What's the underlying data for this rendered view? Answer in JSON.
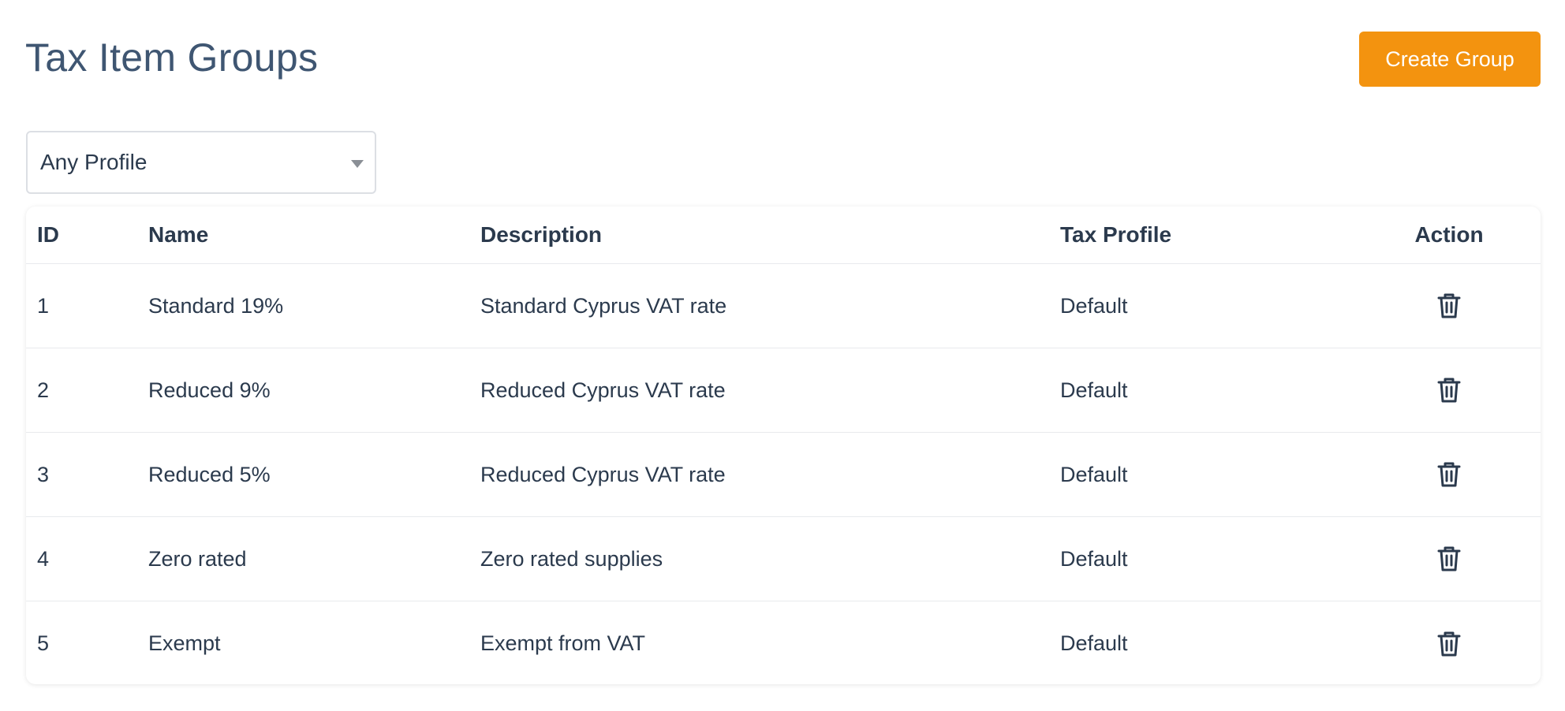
{
  "header": {
    "title": "Tax Item Groups",
    "create_label": "Create Group"
  },
  "filter": {
    "selected": "Any Profile",
    "icon": "chevron-down-icon"
  },
  "table": {
    "columns": {
      "id": "ID",
      "name": "Name",
      "description": "Description",
      "tax_profile": "Tax Profile",
      "action": "Action"
    },
    "rows": [
      {
        "id": "1",
        "name": "Standard 19%",
        "description": "Standard Cyprus VAT rate",
        "tax_profile": "Default",
        "action_icon": "trash-icon"
      },
      {
        "id": "2",
        "name": "Reduced 9%",
        "description": "Reduced Cyprus VAT rate",
        "tax_profile": "Default",
        "action_icon": "trash-icon"
      },
      {
        "id": "3",
        "name": "Reduced 5%",
        "description": "Reduced Cyprus VAT rate",
        "tax_profile": "Default",
        "action_icon": "trash-icon"
      },
      {
        "id": "4",
        "name": "Zero rated",
        "description": "Zero rated supplies",
        "tax_profile": "Default",
        "action_icon": "trash-icon"
      },
      {
        "id": "5",
        "name": "Exempt",
        "description": "Exempt from VAT",
        "tax_profile": "Default",
        "action_icon": "trash-icon"
      }
    ]
  },
  "colors": {
    "accent": "#f3930f",
    "title": "#3f5672",
    "text": "#2b3a4d"
  }
}
